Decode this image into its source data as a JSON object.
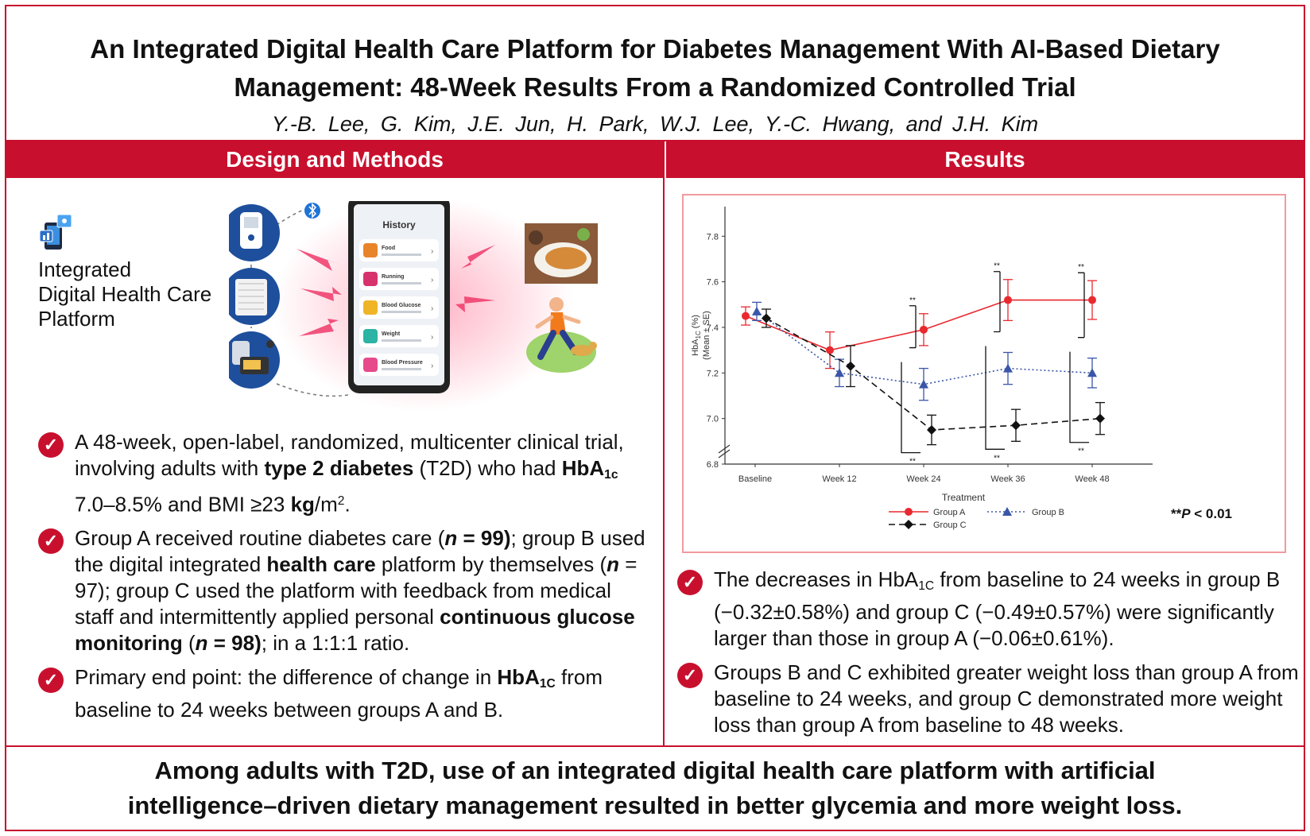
{
  "title": {
    "line1": "An Integrated Digital Health Care Platform for Diabetes Management With AI-Based Dietary",
    "line2": "Management: 48-Week Results From a Randomized Controlled Trial",
    "authors": "Y.-B. Lee, G. Kim, J.E. Jun, H. Park, W.J. Lee, Y.-C. Hwang, and J.H. Kim"
  },
  "sections": {
    "left": "Design and Methods",
    "right": "Results"
  },
  "platform": {
    "label_line1": "Integrated",
    "label_line2a": "Digital",
    "label_line2b": " Health Care",
    "label_line3": "Platform"
  },
  "phone": {
    "header": "History",
    "items": [
      "Food",
      "Running",
      "Blood Glucose",
      "Weight",
      "Blood Pressure"
    ]
  },
  "methods": {
    "b1": {
      "t1": "A 48-week, open-label, randomized, multicenter clinical trial, involving adults with ",
      "t2": "type 2 diabetes",
      "t3": " (T2D) who had ",
      "t4": "HbA",
      "t5": "1c",
      "t6": " 7.0–8.5% and BMI ≥23 ",
      "t7": "kg",
      "t8": "/m",
      "t9": "2",
      "t10": "."
    },
    "b2": {
      "t1": "Group A received routine diabetes care (",
      "t2": "n",
      "t3": " = 99)",
      "t4": "; group B used the digital integrated ",
      "t5": "health care",
      "t6": " platform by themselves (",
      "t7": "n",
      "t8": " = 97); group C used the platform with feedback from medical staff and intermittently applied personal ",
      "t9": "continuous glucose monitoring",
      "t10": " (",
      "t11": "n",
      "t12": " = 98)",
      "t13": "; in a 1:1:1 ratio."
    },
    "b3": {
      "t1": "Primary end point: the difference of change in ",
      "t2": "HbA",
      "t3": "1C",
      "t4": " from baseline to 24 weeks between groups A and B."
    }
  },
  "results": {
    "b1": {
      "t1": "The decreases in ",
      "t2": "HbA",
      "t3": "1C",
      "t4": " from baseline to 24 weeks in group B (−0.32±0.58%) and group C (−0.49±0.57%) were significantly larger than those in group A (−0.06±0.61%)."
    },
    "b2": {
      "t1": "Groups B and C exhibited greater weight loss than group A from baseline to 24 weeks, and group C demonstrated more weight loss than group A from baseline to 48 weeks."
    }
  },
  "conclusion": {
    "line1": "Among adults with T2D, use of an integrated digital health care platform with artificial",
    "line2": "intelligence–driven dietary management resulted in better glycemia and more weight loss."
  },
  "colors": {
    "accent": "#c8102e",
    "groupA": "#e8292f",
    "groupB": "#3a56a8",
    "groupC": "#111111"
  },
  "chart_data": {
    "type": "line",
    "ylabel_main": "HbA",
    "ylabel_sub": "1C",
    "ylabel_unit": " (%)",
    "ylabel_line2": "(Mean ± SE)",
    "categories": [
      "Baseline",
      "Week 12",
      "Week 24",
      "Week 36",
      "Week 48"
    ],
    "yticks": [
      "6.8",
      "7.0",
      "7.2",
      "7.4",
      "7.6",
      "7.8"
    ],
    "ylim": [
      6.8,
      7.8
    ],
    "series": [
      {
        "name": "Group A",
        "values": [
          7.45,
          7.3,
          7.39,
          7.52,
          7.52
        ],
        "se": [
          0.04,
          0.08,
          0.07,
          0.09,
          0.085
        ]
      },
      {
        "name": "Group B",
        "values": [
          7.47,
          7.2,
          7.15,
          7.22,
          7.2
        ],
        "se": [
          0.04,
          0.06,
          0.07,
          0.07,
          0.065
        ]
      },
      {
        "name": "Group C",
        "values": [
          7.44,
          7.23,
          6.95,
          6.97,
          7.0
        ],
        "se": [
          0.04,
          0.09,
          0.065,
          0.07,
          0.07
        ]
      }
    ],
    "significance_marker": "**",
    "legend_title": "Treatment",
    "p_note_prefix": "**",
    "p_note_p": "P",
    "p_note_rest": " < 0.01",
    "legend_placement": "bottom"
  }
}
